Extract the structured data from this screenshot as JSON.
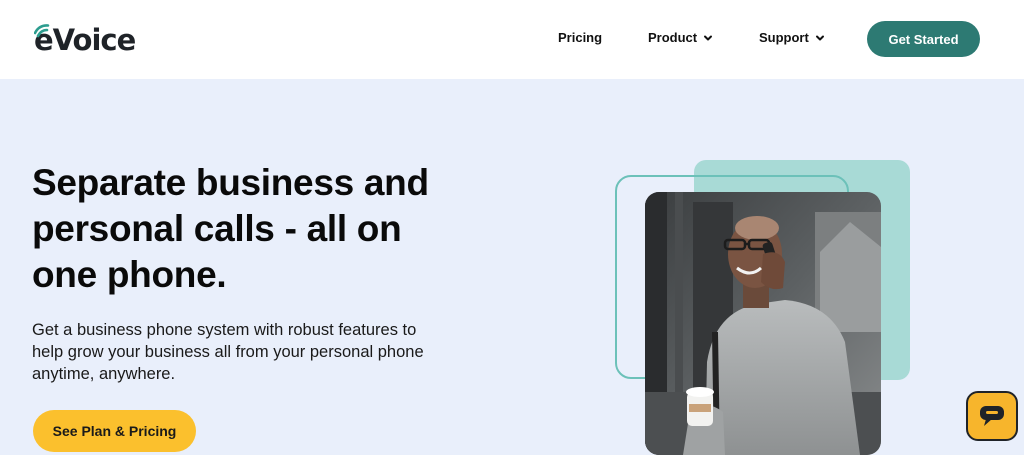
{
  "brand": {
    "name": "eVoice",
    "accent": "#2d7a73"
  },
  "nav": {
    "pricing": "Pricing",
    "product": "Product",
    "support": "Support",
    "get_started": "Get Started"
  },
  "hero": {
    "headline": "Separate business and personal calls - all on one phone.",
    "subtext": "Get a business phone system with robust features to help grow your business all from your personal phone anytime, anywhere.",
    "cta": "See Plan & Pricing",
    "cta_color": "#fbc02d",
    "background": "#e9effb"
  },
  "icons": {
    "dropdown": "chevron-down-icon",
    "chat": "chat-bubble-icon"
  }
}
